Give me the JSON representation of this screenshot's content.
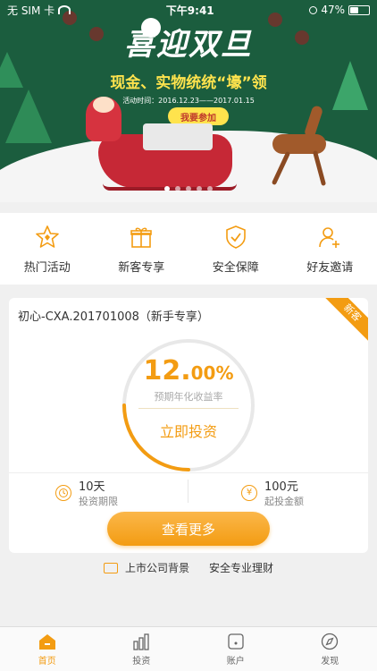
{
  "status_bar": {
    "carrier": "无 SIM 卡",
    "time": "下午9:41",
    "battery_text": "47%",
    "battery_level": 0.47
  },
  "banner": {
    "title": "喜迎双旦",
    "subtitle": "现金、实物统统“壕”领",
    "date": "活动时间：2016.12.23——2017.01.15",
    "join_label": "我要参加",
    "page_count": 5,
    "active_page": 0
  },
  "quick_entries": [
    {
      "label": "热门活动",
      "icon": "star-icon"
    },
    {
      "label": "新客专享",
      "icon": "gift-icon"
    },
    {
      "label": "安全保障",
      "icon": "shield-icon"
    },
    {
      "label": "好友邀请",
      "icon": "invite-user-icon"
    }
  ],
  "product": {
    "name": "初心-CXA.201701008（新手专享）",
    "badge": "新客",
    "rate_int": "12.",
    "rate_dec": "00%",
    "rate_label": "预期年化收益率",
    "progress": 0.25,
    "invest_label": "立即投资",
    "period_value": "10天",
    "period_label": "投资期限",
    "min_value": "100元",
    "min_label": "起投金额",
    "min_icon_glyph": "¥",
    "more_label": "查看更多"
  },
  "trust": {
    "item1": "上市公司背景",
    "item2": "安全专业理财"
  },
  "tabs": [
    {
      "label": "首页",
      "icon": "home-icon",
      "active": true
    },
    {
      "label": "投资",
      "icon": "chart-bars-icon",
      "active": false
    },
    {
      "label": "账户",
      "icon": "wallet-icon",
      "active": false
    },
    {
      "label": "发现",
      "icon": "compass-icon",
      "active": false
    }
  ],
  "colors": {
    "accent": "#f39c12",
    "banner_green": "#1b5d3e"
  }
}
